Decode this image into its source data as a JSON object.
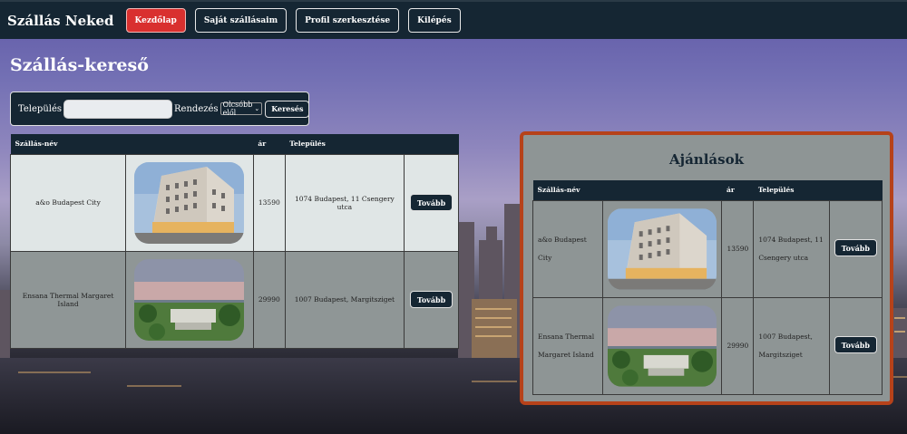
{
  "nav": {
    "brand": "Szállás Neked",
    "items": [
      {
        "label": "Kezdőlap",
        "active": true
      },
      {
        "label": "Saját szállásaim",
        "active": false
      },
      {
        "label": "Profil szerkesztése",
        "active": false
      },
      {
        "label": "Kilépés",
        "active": false
      }
    ]
  },
  "page_title": "Szállás-kereső",
  "search": {
    "city_label": "Település",
    "city_value": "",
    "sort_label": "Rendezés",
    "sort_selected": "Olcsóbb elől",
    "button": "Keresés"
  },
  "table": {
    "headers": [
      "Szállás-név",
      "",
      "ár",
      "Település",
      ""
    ],
    "rows": [
      {
        "name": "a&o Budapest City",
        "image": "building-photo",
        "price": "13590",
        "location": "1074 Budapest, 11 Csengery utca",
        "button": "Tovább"
      },
      {
        "name": "Ensana Thermal Margaret Island",
        "image": "aerial-park-photo",
        "price": "29990",
        "location": "1007 Budapest, Margitsziget",
        "button": "Tovább"
      }
    ]
  },
  "recommendations": {
    "title": "Ajánlások",
    "headers": [
      "Szállás-név",
      "",
      "ár",
      "Település",
      ""
    ],
    "rows": [
      {
        "name": "a&o Budapest City",
        "price": "13590",
        "location": "1074 Budapest, 11 Csengery utca",
        "button": "Tovább"
      },
      {
        "name": "Ensana Thermal Margaret Island",
        "price": "29990",
        "location": "1007 Budapest, Margitsziget",
        "button": "Tovább"
      }
    ]
  },
  "colors": {
    "navbar": "#152633",
    "active_button": "#d9302f",
    "recommend_border": "#b6421a"
  }
}
